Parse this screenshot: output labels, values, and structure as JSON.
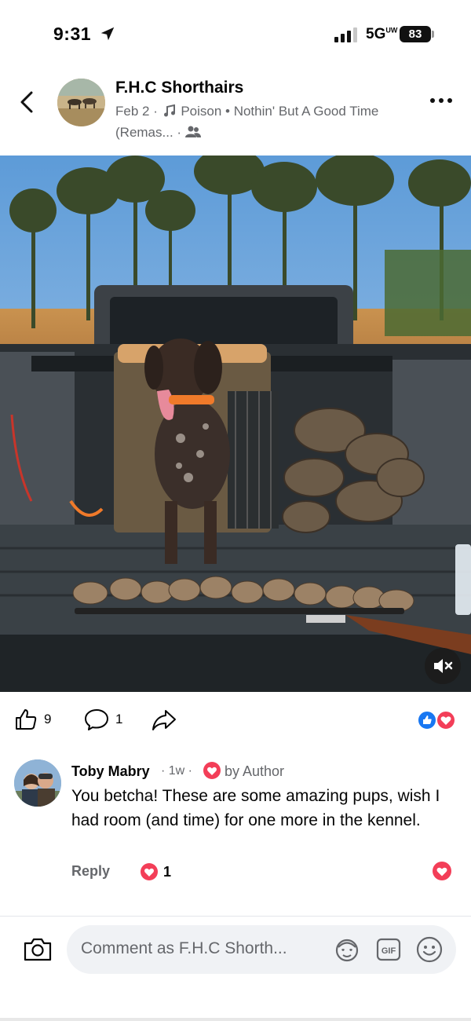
{
  "status_bar": {
    "time": "9:31",
    "network": "5G",
    "network_suffix": "UW",
    "battery": "83"
  },
  "post": {
    "page_name": "F.H.C Shorthairs",
    "date": "Feb 2",
    "separator": " · ",
    "song": "Poison • Nothin' But A Good Time (Remas...",
    "audience_icon": "friends-icon"
  },
  "actions": {
    "like_count": "9",
    "comment_count": "1",
    "reaction_types": [
      "like",
      "love"
    ]
  },
  "comment": {
    "author": "Toby Mabry",
    "time": "· 1w ·",
    "badge": "by Author",
    "text": "You betcha!  These are some amazing pups, wish I had room (and time) for one more in the kennel.",
    "reply_label": "Reply",
    "reaction_count": "1"
  },
  "composer": {
    "placeholder": "Comment as F.H.C Shorth..."
  },
  "colors": {
    "facebook_blue": "#1877f2",
    "love_red": "#f33e58",
    "secondary_text": "#65676b"
  }
}
